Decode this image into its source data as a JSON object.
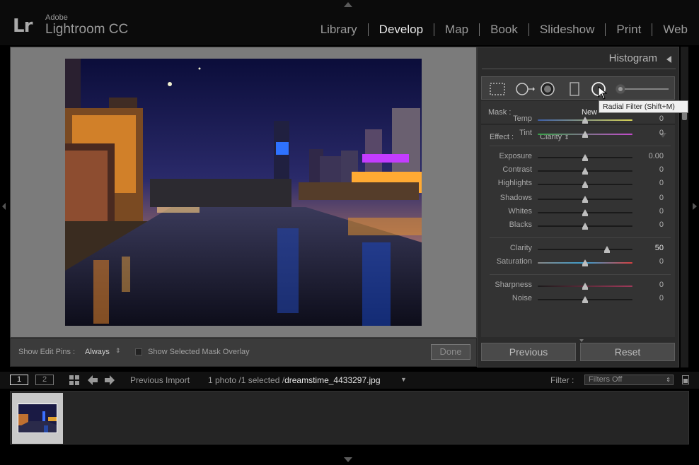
{
  "app": {
    "vendor": "Adobe",
    "name": "Lightroom CC",
    "logo": "Lr"
  },
  "modules": [
    {
      "label": "Library",
      "active": false
    },
    {
      "label": "Develop",
      "active": true
    },
    {
      "label": "Map",
      "active": false
    },
    {
      "label": "Book",
      "active": false
    },
    {
      "label": "Slideshow",
      "active": false
    },
    {
      "label": "Print",
      "active": false
    },
    {
      "label": "Web",
      "active": false
    }
  ],
  "toolbar": {
    "show_pins_label": "Show Edit Pins :",
    "show_pins_value": "Always",
    "mask_overlay_label": "Show Selected Mask Overlay",
    "mask_overlay_checked": false,
    "done_label": "Done"
  },
  "panel": {
    "histogram_title": "Histogram",
    "tools": [
      "crop-overlay-icon",
      "spot-removal-icon",
      "red-eye-icon",
      "graduated-filter-icon",
      "radial-filter-icon",
      "adjustment-brush-icon"
    ],
    "tooltip": "Radial Filter (Shift+M)",
    "mask_label": "Mask :",
    "mask_value": "New",
    "effect_label": "Effect :",
    "effect_value": "Clarity",
    "sliders": [
      {
        "label": "Temp",
        "value": "0",
        "position": 0.5,
        "gradient": "temp",
        "group": 1
      },
      {
        "label": "Tint",
        "value": "0",
        "position": 0.5,
        "gradient": "tint",
        "group": 1
      },
      {
        "label": "Exposure",
        "value": "0.00",
        "position": 0.5,
        "gradient": "none",
        "group": 2
      },
      {
        "label": "Contrast",
        "value": "0",
        "position": 0.5,
        "gradient": "none",
        "group": 2
      },
      {
        "label": "Highlights",
        "value": "0",
        "position": 0.5,
        "gradient": "none",
        "group": 2
      },
      {
        "label": "Shadows",
        "value": "0",
        "position": 0.5,
        "gradient": "none",
        "group": 2
      },
      {
        "label": "Whites",
        "value": "0",
        "position": 0.5,
        "gradient": "none",
        "group": 2
      },
      {
        "label": "Blacks",
        "value": "0",
        "position": 0.5,
        "gradient": "none",
        "group": 2
      },
      {
        "label": "Clarity",
        "value": "50",
        "position": 0.73,
        "gradient": "none",
        "group": 3,
        "strong": true
      },
      {
        "label": "Saturation",
        "value": "0",
        "position": 0.5,
        "gradient": "sat",
        "group": 3
      },
      {
        "label": "Sharpness",
        "value": "0",
        "position": 0.5,
        "gradient": "sharp",
        "group": 4
      },
      {
        "label": "Noise",
        "value": "0",
        "position": 0.5,
        "gradient": "none",
        "group": 4
      }
    ],
    "previous_label": "Previous",
    "reset_label": "Reset"
  },
  "filmstrip": {
    "screen1": "1",
    "screen2": "2",
    "source": "Previous Import",
    "count_text": "1 photo /1 selected /",
    "filename": "dreamstime_4433297.jpg",
    "filter_label": "Filter :",
    "filter_value": "Filters Off"
  },
  "colors": {
    "accent": "#e8e8e8",
    "panel_bg": "#333333",
    "image_bg": "#7b7b7b"
  }
}
